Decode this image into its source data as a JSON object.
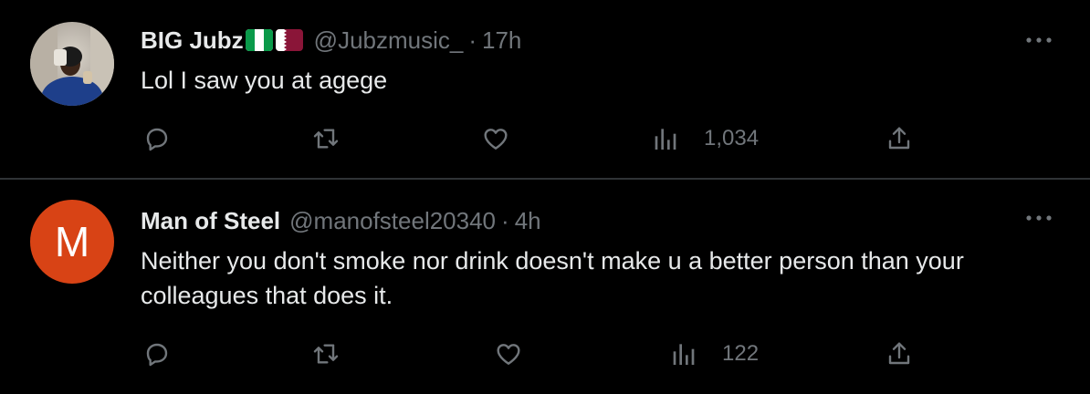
{
  "tweets": [
    {
      "author": "BIG Jubz",
      "handle": "@Jubzmusic_",
      "separator": "·",
      "time": "17h",
      "text": "Lol I saw you at agege",
      "avatar": {
        "type": "photo"
      },
      "flags": [
        "nigeria-flag",
        "qatar-flag"
      ],
      "actions": {
        "reply_icon": "reply-icon",
        "retweet_icon": "retweet-icon",
        "like_icon": "heart-icon",
        "views_icon": "analytics-icon",
        "views": "1,034",
        "share_icon": "share-icon"
      }
    },
    {
      "author": "Man of Steel",
      "handle": "@manofsteel20340",
      "separator": "·",
      "time": "4h",
      "text": "Neither you don't smoke nor drink doesn't make u a better person than your colleagues that does it.",
      "avatar": {
        "type": "letter",
        "letter": "M",
        "color": "#d84315"
      },
      "actions": {
        "reply_icon": "reply-icon",
        "retweet_icon": "retweet-icon",
        "like_icon": "heart-icon",
        "views_icon": "analytics-icon",
        "views": "122",
        "share_icon": "share-icon"
      }
    }
  ],
  "theme": {
    "background": "#000000",
    "text": "#e7e9ea",
    "secondary_text": "#71767b",
    "divider": "#2f3336"
  }
}
